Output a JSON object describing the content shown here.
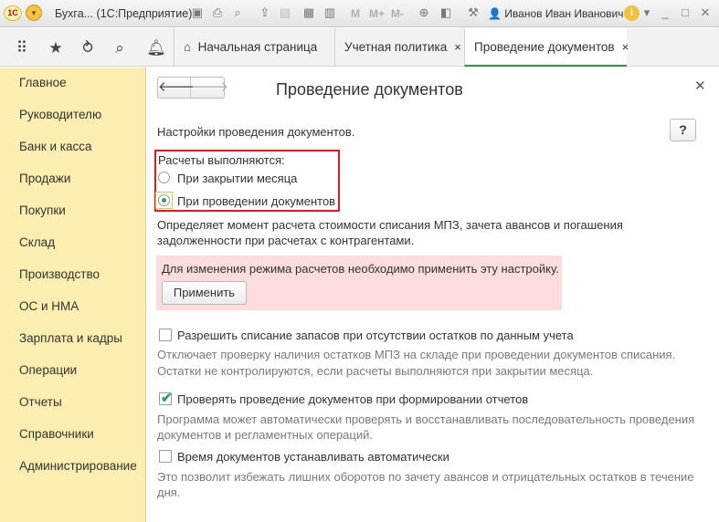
{
  "titlebar": {
    "logo": "1С",
    "title": "Бухга... (1С:Предприятие)",
    "m_labels": [
      "M",
      "M+",
      "M-"
    ],
    "user": "Иванов Иван Иванович",
    "info_icon": "i"
  },
  "tabs": [
    {
      "label": "Начальная страница"
    },
    {
      "label": "Учетная политика",
      "close": "×"
    },
    {
      "label": "Проведение документов",
      "close": "×"
    }
  ],
  "sidebar": {
    "items": [
      {
        "label": "Главное"
      },
      {
        "label": "Руководителю"
      },
      {
        "label": "Банк и касса"
      },
      {
        "label": "Продажи"
      },
      {
        "label": "Покупки"
      },
      {
        "label": "Склад"
      },
      {
        "label": "Производство"
      },
      {
        "label": "ОС и НМА"
      },
      {
        "label": "Зарплата и кадры"
      },
      {
        "label": "Операции"
      },
      {
        "label": "Отчеты"
      },
      {
        "label": "Справочники"
      },
      {
        "label": "Администрирование"
      }
    ]
  },
  "main": {
    "title": "Проведение документов",
    "subtitle": "Настройки проведения документов.",
    "help": "?",
    "radio_group_label": "Расчеты выполняются:",
    "radio_options": [
      {
        "label": "При закрытии месяца",
        "selected": false
      },
      {
        "label": "При проведении документов",
        "selected": true
      }
    ],
    "radio_desc": [
      "Определяет момент расчета стоимости списания МПЗ, зачета авансов и погашения",
      "задолженности при расчетах с контрагентами."
    ],
    "warning": {
      "text": "Для изменения режима расчетов необходимо применить эту настройку.",
      "apply_label": "Применить",
      "bg_color": "#fcdcdc"
    },
    "options": [
      {
        "label": "Разрешить списание запасов при отсутствии остатков по данным учета",
        "checked": false,
        "desc": [
          "Отключает проверку наличия остатков МПЗ на складе при проведении документов списания.",
          "Остатки не контролируются, если расчеты выполняются при закрытии месяца."
        ]
      },
      {
        "label": "Проверять проведение документов при формировании отчетов",
        "checked": true,
        "desc": [
          "Программа может автоматически проверять и восстанавливать последовательность проведения",
          "документов и регламентных операций."
        ]
      },
      {
        "label": "Время документов устанавливать автоматически",
        "checked": false,
        "desc": [
          "Это позволит избежать лишних оборотов по зачету авансов и отрицательных остатков в течение",
          "дня."
        ]
      }
    ]
  },
  "colors": {
    "sidebar_bg": "#fbeeb0",
    "accent_green": "#1a9f3c",
    "highlight_red": "#e01b1b"
  }
}
